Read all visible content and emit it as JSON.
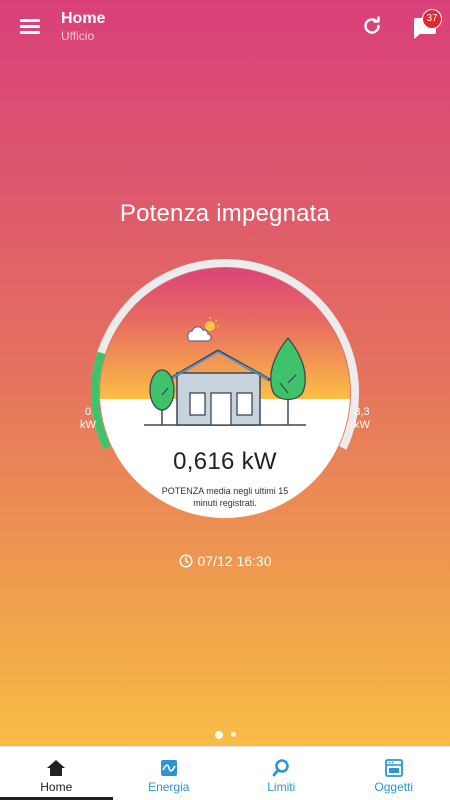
{
  "app_bar": {
    "title": "Home",
    "subtitle": "Ufficio",
    "notifications_count": "37",
    "icons": {
      "menu": "hamburger-menu-icon",
      "refresh": "refresh-icon",
      "messages": "chat-bubble-icon"
    }
  },
  "gauge": {
    "title": "Potenza impegnata",
    "value": "0,616 kW",
    "description": "POTENZA media negli ultimi 15 minuti registrati.",
    "min_value": "0",
    "min_unit": "kW",
    "max_value": "3,3",
    "max_unit": "kW",
    "fill_fraction": 0.187,
    "colors": {
      "fill": "#3ec26a",
      "track": "#ececec",
      "sky_top": "#dc3f7e",
      "sky_bottom": "#fbbd45"
    }
  },
  "timestamp": {
    "icon": "clock-icon",
    "text": "07/12 16:30"
  },
  "pager": {
    "count": 2,
    "active": 0
  },
  "bottom_nav": [
    {
      "label": "Home",
      "icon": "home-icon",
      "active": true
    },
    {
      "label": "Energia",
      "icon": "energy-chart-icon",
      "active": false
    },
    {
      "label": "Limiti",
      "icon": "search-icon",
      "active": false
    },
    {
      "label": "Oggetti",
      "icon": "appliance-icon",
      "active": false
    }
  ],
  "accent_color": "#2a96d6"
}
